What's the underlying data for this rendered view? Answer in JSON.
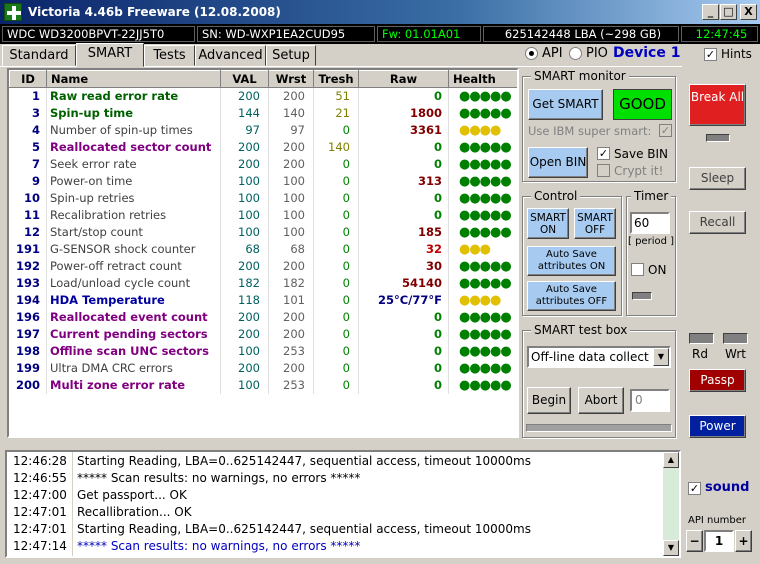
{
  "window": {
    "title": "Victoria 4.46b Freeware (12.08.2008)",
    "min_label": "_",
    "max_label": "□",
    "close_label": "X"
  },
  "statusbar": {
    "model": "WDC WD3200BPVT-22JJ5T0",
    "serial": "SN: WD-WXP1EA2CUD95",
    "firmware": "Fw: 01.01A01",
    "lba": "625142448 LBA (~298 GB)",
    "clock": "12:47:45"
  },
  "tabs": [
    "Standard",
    "SMART",
    "Tests",
    "Advanced",
    "Setup"
  ],
  "interface": {
    "api_label": "API",
    "pio_label": "PIO",
    "device_label": "Device 1",
    "hints_label": "Hints"
  },
  "smart_table": {
    "headers": [
      "ID",
      "Name",
      "VAL",
      "Wrst",
      "Tresh",
      "Raw",
      "Health"
    ],
    "rows": [
      {
        "id": "1",
        "name": "Raw read error rate",
        "val": "200",
        "wrst": "200",
        "tresh": "51",
        "raw": "0",
        "health": "●●●●●"
      },
      {
        "id": "3",
        "name": "Spin-up time",
        "val": "144",
        "wrst": "140",
        "tresh": "21",
        "raw": "1800",
        "health": "●●●●●"
      },
      {
        "id": "4",
        "name": "Number of spin-up times",
        "val": "97",
        "wrst": "97",
        "tresh": "0",
        "raw": "3361",
        "health": "●●●●"
      },
      {
        "id": "5",
        "name": "Reallocated sector count",
        "val": "200",
        "wrst": "200",
        "tresh": "140",
        "raw": "0",
        "health": "●●●●●"
      },
      {
        "id": "7",
        "name": "Seek error rate",
        "val": "200",
        "wrst": "200",
        "tresh": "0",
        "raw": "0",
        "health": "●●●●●"
      },
      {
        "id": "9",
        "name": "Power-on time",
        "val": "100",
        "wrst": "100",
        "tresh": "0",
        "raw": "313",
        "health": "●●●●●"
      },
      {
        "id": "10",
        "name": "Spin-up retries",
        "val": "100",
        "wrst": "100",
        "tresh": "0",
        "raw": "0",
        "health": "●●●●●"
      },
      {
        "id": "11",
        "name": "Recalibration retries",
        "val": "100",
        "wrst": "100",
        "tresh": "0",
        "raw": "0",
        "health": "●●●●●"
      },
      {
        "id": "12",
        "name": "Start/stop count",
        "val": "100",
        "wrst": "100",
        "tresh": "0",
        "raw": "185",
        "health": "●●●●●"
      },
      {
        "id": "191",
        "name": "G-SENSOR shock counter",
        "val": "68",
        "wrst": "68",
        "tresh": "0",
        "raw": "32",
        "health": "●●●"
      },
      {
        "id": "192",
        "name": "Power-off retract count",
        "val": "200",
        "wrst": "200",
        "tresh": "0",
        "raw": "30",
        "health": "●●●●●"
      },
      {
        "id": "193",
        "name": "Load/unload cycle count",
        "val": "182",
        "wrst": "182",
        "tresh": "0",
        "raw": "54140",
        "health": "●●●●●"
      },
      {
        "id": "194",
        "name": "HDA Temperature",
        "val": "118",
        "wrst": "101",
        "tresh": "0",
        "raw": "25°C/77°F",
        "health": "●●●●"
      },
      {
        "id": "196",
        "name": "Reallocated event count",
        "val": "200",
        "wrst": "200",
        "tresh": "0",
        "raw": "0",
        "health": "●●●●●"
      },
      {
        "id": "197",
        "name": "Current pending sectors",
        "val": "200",
        "wrst": "200",
        "tresh": "0",
        "raw": "0",
        "health": "●●●●●"
      },
      {
        "id": "198",
        "name": "Offline scan UNC sectors",
        "val": "100",
        "wrst": "253",
        "tresh": "0",
        "raw": "0",
        "health": "●●●●●"
      },
      {
        "id": "199",
        "name": "Ultra DMA CRC errors",
        "val": "200",
        "wrst": "200",
        "tresh": "0",
        "raw": "0",
        "health": "●●●●●"
      },
      {
        "id": "200",
        "name": "Multi zone error rate",
        "val": "100",
        "wrst": "253",
        "tresh": "0",
        "raw": "0",
        "health": "●●●●●"
      }
    ]
  },
  "smart_monitor": {
    "title": "SMART monitor",
    "get_smart": "Get SMART",
    "status": "GOOD",
    "ibm_label": "Use IBM super smart:",
    "open_bin": "Open BIN",
    "save_bin": "Save BIN",
    "crypt": "Crypt it!"
  },
  "control": {
    "title": "Control",
    "smart_on": "SMART ON",
    "smart_off": "SMART OFF",
    "autosave_on": "Auto Save attributes ON",
    "autosave_off": "Auto Save attributes OFF"
  },
  "timer": {
    "title": "Timer",
    "value": "60",
    "period": "[ period ]",
    "on_label": "ON"
  },
  "testbox": {
    "title": "SMART test box",
    "selected": "Off-line data collect",
    "begin": "Begin",
    "abort": "Abort",
    "value": "0"
  },
  "side": {
    "break_all": "Break All",
    "sleep": "Sleep",
    "recall": "Recall",
    "rd": "Rd",
    "wrt": "Wrt",
    "passp": "Passp",
    "power": "Power",
    "sound": "sound",
    "api_number_label": "API number",
    "api_number": "1",
    "minus": "−",
    "plus": "+"
  },
  "log": [
    {
      "time": "12:46:28",
      "msg": "Starting Reading, LBA=0..625142447, sequential access, timeout 10000ms",
      "color": "#000000"
    },
    {
      "time": "12:46:55",
      "msg": "***** Scan results: no warnings, no errors *****",
      "color": "#000000"
    },
    {
      "time": "12:47:00",
      "msg": "Get passport... OK",
      "color": "#000000"
    },
    {
      "time": "12:47:01",
      "msg": "Recallibration... OK",
      "color": "#000000"
    },
    {
      "time": "12:47:01",
      "msg": "Starting Reading, LBA=0..625142447, sequential access, timeout 10000ms",
      "color": "#000000"
    },
    {
      "time": "12:47:14",
      "msg": "***** Scan results: no warnings, no errors *****",
      "color": "#0000c0"
    }
  ],
  "colors": {
    "good": "#00e000",
    "break": "#e02020",
    "passp": "#a00000",
    "power": "#0020a0",
    "health_green": "#008000",
    "health_yellow": "#e0c000"
  }
}
